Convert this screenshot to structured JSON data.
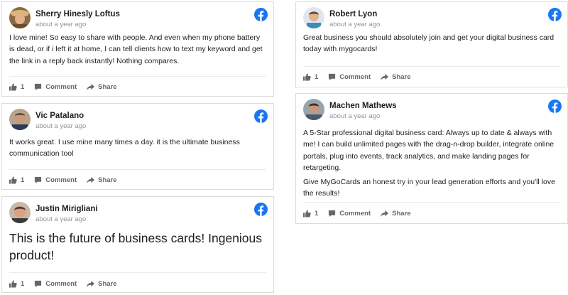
{
  "colors": {
    "facebook_blue": "#1877f2",
    "muted": "#65676b",
    "timestamp": "#90949c"
  },
  "icons": {
    "platform": "facebook-icon",
    "like": "thumbs-up-icon",
    "comment": "comment-icon",
    "share": "share-icon"
  },
  "labels": {
    "comment": "Comment",
    "share": "Share"
  },
  "reviews": [
    {
      "name": "Sherry Hinesly Loftus",
      "time": "about a year ago",
      "paragraphs": [
        "I love mine! So easy to share with people. And even when my phone battery is dead, or if i left it at home, I can tell clients how to text my keyword and get the link in a reply back instantly! Nothing compares."
      ],
      "likes": "1"
    },
    {
      "name": "Vic Patalano",
      "time": "about a year ago",
      "paragraphs": [
        "It works great. I use mine many times a day. it is the ultimate business communication tool"
      ],
      "likes": "1"
    },
    {
      "name": "Justin Mirigliani",
      "time": "about a year ago",
      "paragraphs": [
        "This is the future of business cards! Ingenious product!"
      ],
      "likes": "1"
    },
    {
      "name": "Robert Lyon",
      "time": "about a year ago",
      "paragraphs": [
        "Great business you should absolutely join and get your digital business card today with mygocards!"
      ],
      "likes": "1"
    },
    {
      "name": "Machen Mathews",
      "time": "about a year ago",
      "paragraphs": [
        "A 5-Star professional digital business card: Always up to date & always with me! I can build unlimited pages with the drag-n-drop builder, integrate online portals, plug into events, track analytics, and make landing pages for retargeting.",
        "Give MyGoCards an honest try in your lead generation efforts and you'll love the results!"
      ],
      "likes": "1"
    }
  ]
}
